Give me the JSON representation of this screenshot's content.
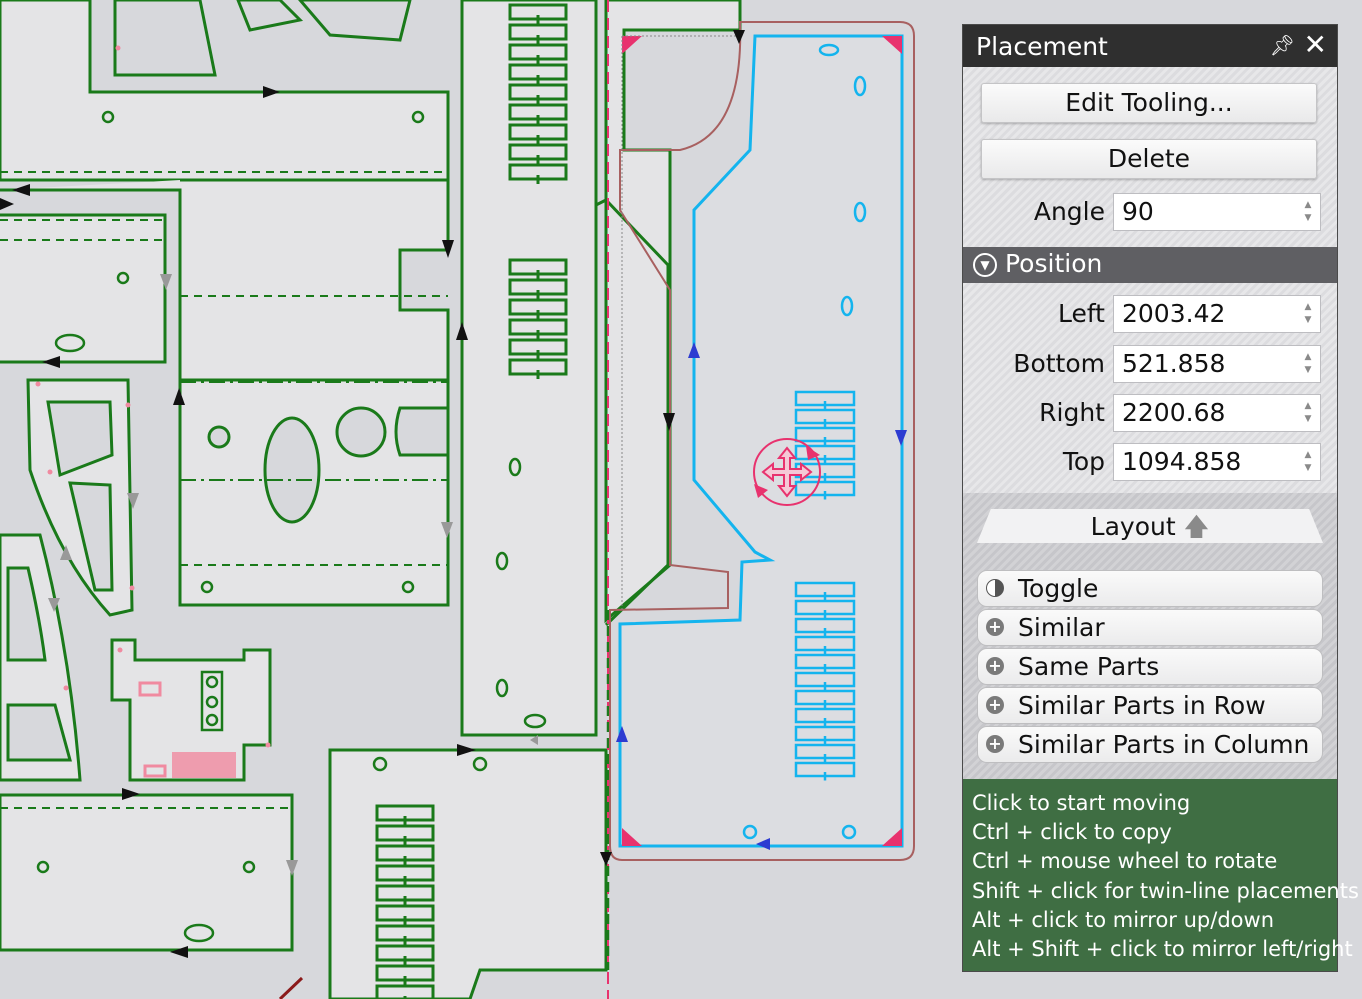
{
  "panel": {
    "title": "Placement",
    "edit_tooling_label": "Edit Tooling...",
    "delete_label": "Delete",
    "angle_label": "Angle",
    "angle_value": "90",
    "position_header": "Position",
    "left_label": "Left",
    "left_value": "2003.42",
    "bottom_label": "Bottom",
    "bottom_value": "521.858",
    "right_label": "Right",
    "right_value": "2200.68",
    "top_label": "Top",
    "top_value": "1094.858",
    "layout_label": "Layout",
    "options": [
      {
        "label": "Toggle",
        "icon": "half-circle-icon"
      },
      {
        "label": "Similar",
        "icon": "plus-icon"
      },
      {
        "label": "Same Parts",
        "icon": "plus-icon"
      },
      {
        "label": "Similar Parts in Row",
        "icon": "plus-icon"
      },
      {
        "label": "Similar Parts in Column",
        "icon": "plus-icon"
      }
    ],
    "tips": [
      "Click to start moving",
      "Ctrl + click to copy",
      "Ctrl + mouse wheel to rotate",
      "Shift + click for twin-line placements",
      "Alt + click to mirror up/down",
      "Alt + Shift + click to mirror left/right"
    ]
  },
  "colors": {
    "part_outline": "#1a7a1a",
    "selected_part": "#14b4ee",
    "sheet_edge": "#e8326e",
    "direction_arrow": "#2d3bd1",
    "tips_bg": "#3f6e43",
    "title_bg": "#2f2f2f"
  }
}
